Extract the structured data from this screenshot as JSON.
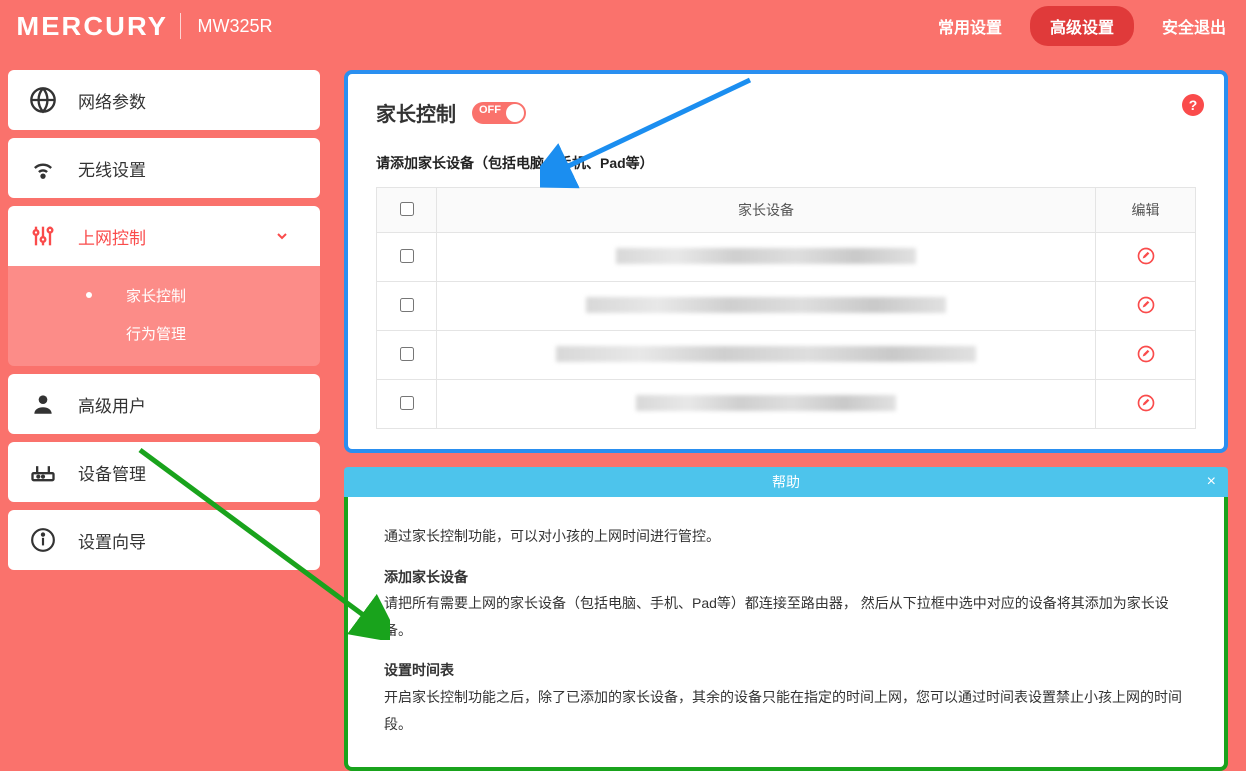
{
  "header": {
    "brand": "MERCURY",
    "model": "MW325R",
    "nav": {
      "basic": "常用设置",
      "advanced": "高级设置",
      "logout": "安全退出"
    }
  },
  "sidebar": {
    "network": "网络参数",
    "wireless": "无线设置",
    "access": "上网控制",
    "parental": "家长控制",
    "behavior": "行为管理",
    "advuser": "高级用户",
    "device": "设备管理",
    "wizard": "设置向导"
  },
  "panel": {
    "title": "家长控制",
    "toggle_label": "OFF",
    "instruction": "请添加家长设备（包括电脑、手机、Pad等）",
    "col_device": "家长设备",
    "col_edit": "编辑"
  },
  "help": {
    "bar_title": "帮助",
    "p1": "通过家长控制功能，可以对小孩的上网时间进行管控。",
    "t1": "添加家长设备",
    "p2": "请把所有需要上网的家长设备（包括电脑、手机、Pad等）都连接至路由器， 然后从下拉框中选中对应的设备将其添加为家长设备。",
    "t2": "设置时间表",
    "p3": "开启家长控制功能之后，除了已添加的家长设备，其余的设备只能在指定的时间上网，您可以通过时间表设置禁止小孩上网的时间段。"
  },
  "colors": {
    "accent": "#fa4b4b",
    "bg": "#fa726c",
    "blue": "#2a8ff0",
    "green": "#19a31c",
    "help": "#4dc4ec"
  }
}
